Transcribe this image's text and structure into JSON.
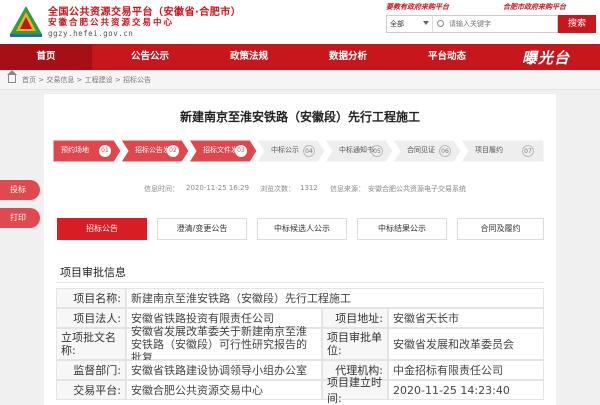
{
  "header": {
    "title_line1": "全国公共资源交易平台（安徽省·合肥市）",
    "title_line2": "安徽合肥公共资源交易中心",
    "domain": "ggzy.hefei.gov.cn",
    "slogan_left": "要教有政府来购平台",
    "slogan_right": "合肥市政府来购平台",
    "search": {
      "category": "全部",
      "placeholder": "请输入关键字",
      "button": "搜索"
    }
  },
  "nav": {
    "items": [
      {
        "label": "首页",
        "active": true
      },
      {
        "label": "公告公示",
        "active": false
      },
      {
        "label": "政策法规",
        "active": false
      },
      {
        "label": "数据分析",
        "active": false
      },
      {
        "label": "平台动态",
        "active": false
      }
    ],
    "brand_logo": "曝光台"
  },
  "breadcrumb": {
    "path": "首页 > 交易信息 > 工程建设 > 招标公告"
  },
  "page": {
    "title": "新建南京至淮安铁路（安徽段）先行工程施工",
    "steps": [
      {
        "label": "预约场地",
        "num": "01",
        "done": true
      },
      {
        "label": "招标公告发布",
        "num": "02",
        "done": true
      },
      {
        "label": "招标文件发布",
        "num": "03",
        "done": true
      },
      {
        "label": "中标公示",
        "num": "04",
        "done": false
      },
      {
        "label": "中标通知书",
        "num": "05",
        "done": false
      },
      {
        "label": "合同见证",
        "num": "06",
        "done": false
      },
      {
        "label": "项目履约",
        "num": "07",
        "done": false
      }
    ],
    "meta": {
      "time_label": "信息时间：",
      "time": "2020-11-25 16:29",
      "views_label": "浏览次数：",
      "views": "1312",
      "source_label": "信息来源：",
      "source": "安徽合肥公共资源电子交易系统"
    },
    "side_buttons": [
      "投标",
      "打印"
    ],
    "tabs": [
      {
        "label": "招标公告",
        "active": true
      },
      {
        "label": "澄清/变更公告",
        "active": false
      },
      {
        "label": "中标候选人公示",
        "active": false
      },
      {
        "label": "中标结果公示",
        "active": false
      },
      {
        "label": "合同及履约",
        "active": false
      }
    ],
    "section_title": "项目审批信息",
    "rows": [
      {
        "l1": "项目名称:",
        "v1": "新建南京至淮安铁路（安徽段）先行工程施工",
        "l2": "",
        "v2": ""
      },
      {
        "l1": "项目法人:",
        "v1": "安徽省铁路投资有限责任公司",
        "l2": "项目地址:",
        "v2": "安徽省天长市"
      },
      {
        "l1": "立项批文名称:",
        "v1": "安徽省发展改革委关于新建南京至淮安铁路（安徽段）可行性研究报告的批复",
        "l2": "项目审批单位:",
        "v2": "安徽省发展和改革委员会"
      },
      {
        "l1": "监督部门:",
        "v1": "安徽省铁路建设协调领导小组办公室",
        "l2": "代理机构:",
        "v2": "中金招标有限责任公司"
      },
      {
        "l1": "交易平台:",
        "v1": "安徽合肥公共资源交易中心",
        "l2": "项目建立时间:",
        "v2": "2020-11-25 14:23:40"
      }
    ]
  },
  "colors": {
    "brand_red": "#c8161d",
    "step_done": "#e0464c",
    "step_pending": "#eeeeee"
  }
}
